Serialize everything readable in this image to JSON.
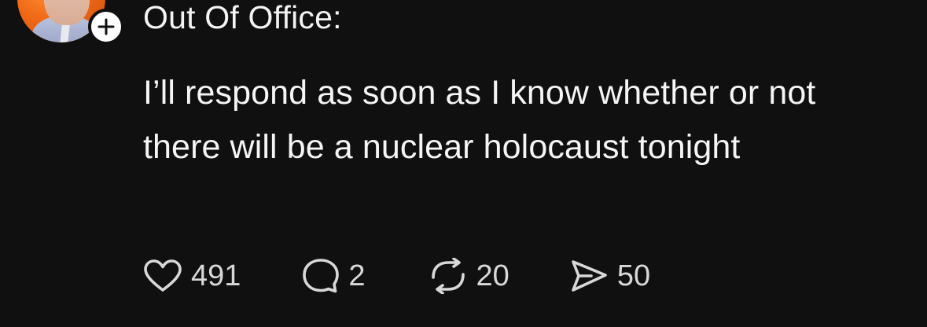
{
  "post": {
    "title": "Out Of Office:",
    "body": "I’ll respond as soon as I know whether or not there will be a nuclear holocaust tonight",
    "avatar_icon": "profile-photo",
    "follow_icon": "plus-icon",
    "actions": {
      "likes": "491",
      "replies": "2",
      "reposts": "20",
      "shares": "50"
    }
  },
  "colors": {
    "background": "#101010",
    "text": "#f3f3f3",
    "secondary_text": "#d8d8d8",
    "avatar_accent": "#f26a17",
    "badge": "#ffffff"
  }
}
